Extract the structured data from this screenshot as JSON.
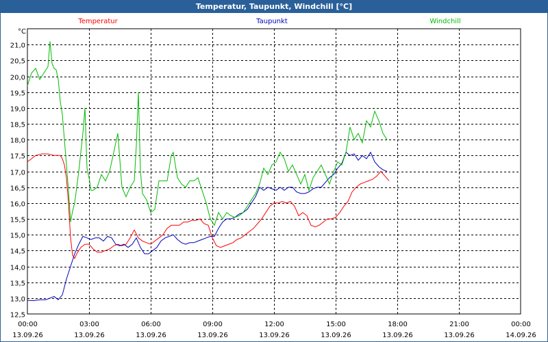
{
  "window": {
    "title": "Temperatur, Taupunkt, Windchill [°C]"
  },
  "chart_data": {
    "type": "line",
    "title": "Temperatur, Taupunkt, Windchill [°C]",
    "ylabel": "°C",
    "xlabel": "",
    "ylim": [
      12.5,
      21.5
    ],
    "y_ticks": [
      "12,5",
      "13,0",
      "13,5",
      "14,0",
      "14,5",
      "15,0",
      "15,5",
      "16,0",
      "16,5",
      "17,0",
      "17,5",
      "18,0",
      "18,5",
      "19,0",
      "19,5",
      "20,0",
      "20,5",
      "21,0"
    ],
    "xlim_hours": [
      0,
      24
    ],
    "x_ticks": [
      {
        "time": "00:00",
        "date": "13.09.26"
      },
      {
        "time": "03:00",
        "date": "13.09.26"
      },
      {
        "time": "06:00",
        "date": "13.09.26"
      },
      {
        "time": "09:00",
        "date": "13.09.26"
      },
      {
        "time": "12:00",
        "date": "13.09.26"
      },
      {
        "time": "15:00",
        "date": "13.09.26"
      },
      {
        "time": "18:00",
        "date": "13.09.26"
      },
      {
        "time": "21:00",
        "date": "13.09.26"
      },
      {
        "time": "00:00",
        "date": "14.09.26"
      }
    ],
    "grid": true,
    "legend_placement": "top",
    "series": [
      {
        "name": "Temperatur",
        "color": "#ff0000",
        "x": [
          0.0,
          0.2,
          0.4,
          0.7,
          1.0,
          1.3,
          1.6,
          1.7,
          1.8,
          1.9,
          2.0,
          2.1,
          2.2,
          2.3,
          2.4,
          2.6,
          2.8,
          3.0,
          3.2,
          3.4,
          3.6,
          3.8,
          4.0,
          4.2,
          4.4,
          4.6,
          4.8,
          5.0,
          5.2,
          5.4,
          5.6,
          5.8,
          6.0,
          6.2,
          6.4,
          6.6,
          6.8,
          7.0,
          7.2,
          7.4,
          7.6,
          7.8,
          8.0,
          8.2,
          8.4,
          8.6,
          8.8,
          9.0,
          9.2,
          9.4,
          9.6,
          9.8,
          10.0,
          10.2,
          10.4,
          10.6,
          10.8,
          11.0,
          11.2,
          11.4,
          11.6,
          11.8,
          12.0,
          12.2,
          12.4,
          12.6,
          12.8,
          13.0,
          13.2,
          13.4,
          13.6,
          13.8,
          14.0,
          14.2,
          14.4,
          14.6,
          14.8,
          15.0,
          15.2,
          15.4,
          15.6,
          15.8,
          16.0,
          16.2,
          16.4,
          16.6,
          16.8,
          17.0,
          17.2,
          17.4,
          17.6
        ],
        "values": [
          17.3,
          17.4,
          17.5,
          17.55,
          17.55,
          17.5,
          17.5,
          17.4,
          17.2,
          16.8,
          16.0,
          14.9,
          14.35,
          14.25,
          14.4,
          14.6,
          14.7,
          14.7,
          14.55,
          14.45,
          14.45,
          14.5,
          14.55,
          14.65,
          14.7,
          14.65,
          14.7,
          14.9,
          15.15,
          14.9,
          14.8,
          14.75,
          14.7,
          14.8,
          14.9,
          15.0,
          15.2,
          15.3,
          15.3,
          15.3,
          15.4,
          15.4,
          15.45,
          15.45,
          15.5,
          15.35,
          15.3,
          14.9,
          14.65,
          14.6,
          14.65,
          14.7,
          14.75,
          14.85,
          14.9,
          15.0,
          15.1,
          15.2,
          15.35,
          15.5,
          15.7,
          15.9,
          16.0,
          16.0,
          16.05,
          16.0,
          16.05,
          15.9,
          15.6,
          15.7,
          15.6,
          15.3,
          15.25,
          15.3,
          15.4,
          15.5,
          15.5,
          15.55,
          15.7,
          15.9,
          16.05,
          16.35,
          16.5,
          16.6,
          16.65,
          16.7,
          16.75,
          16.85,
          17.0,
          16.85,
          16.7
        ]
      },
      {
        "name": "Taupunkt",
        "color": "#0000c0",
        "x": [
          0.0,
          0.3,
          0.6,
          0.9,
          1.1,
          1.3,
          1.5,
          1.7,
          1.9,
          2.1,
          2.3,
          2.5,
          2.7,
          2.9,
          3.1,
          3.3,
          3.5,
          3.7,
          3.9,
          4.1,
          4.3,
          4.5,
          4.7,
          4.9,
          5.1,
          5.3,
          5.5,
          5.7,
          5.9,
          6.1,
          6.3,
          6.5,
          6.7,
          6.9,
          7.1,
          7.3,
          7.5,
          7.7,
          7.9,
          8.1,
          8.3,
          8.5,
          8.7,
          8.9,
          9.1,
          9.3,
          9.5,
          9.7,
          9.9,
          10.1,
          10.3,
          10.5,
          10.7,
          10.9,
          11.1,
          11.3,
          11.5,
          11.7,
          11.9,
          12.1,
          12.3,
          12.5,
          12.7,
          12.9,
          13.1,
          13.3,
          13.5,
          13.7,
          13.9,
          14.1,
          14.3,
          14.5,
          14.7,
          14.9,
          15.1,
          15.3,
          15.5,
          15.7,
          15.9,
          16.1,
          16.3,
          16.5,
          16.7,
          16.9,
          17.1,
          17.3,
          17.5
        ],
        "values": [
          12.93,
          12.92,
          12.95,
          12.95,
          13.0,
          13.05,
          12.95,
          13.1,
          13.6,
          14.0,
          14.4,
          14.7,
          14.95,
          14.9,
          14.85,
          14.9,
          14.9,
          14.8,
          14.95,
          14.9,
          14.7,
          14.65,
          14.7,
          14.6,
          14.7,
          14.9,
          14.6,
          14.4,
          14.4,
          14.5,
          14.6,
          14.8,
          14.9,
          14.95,
          15.0,
          14.85,
          14.75,
          14.7,
          14.75,
          14.75,
          14.8,
          14.85,
          14.9,
          14.95,
          14.95,
          15.2,
          15.4,
          15.5,
          15.5,
          15.55,
          15.65,
          15.7,
          15.8,
          16.0,
          16.2,
          16.5,
          16.4,
          16.5,
          16.45,
          16.4,
          16.5,
          16.4,
          16.5,
          16.5,
          16.35,
          16.3,
          16.3,
          16.35,
          16.45,
          16.5,
          16.5,
          16.65,
          16.8,
          16.9,
          17.1,
          17.25,
          17.6,
          17.5,
          17.55,
          17.35,
          17.5,
          17.4,
          17.6,
          17.3,
          17.15,
          17.05,
          17.0
        ]
      },
      {
        "name": "Windchill",
        "color": "#00bb00",
        "x": [
          0.0,
          0.2,
          0.4,
          0.6,
          0.8,
          1.0,
          1.1,
          1.2,
          1.3,
          1.4,
          1.5,
          1.6,
          1.7,
          1.8,
          1.9,
          2.0,
          2.1,
          2.2,
          2.3,
          2.4,
          2.5,
          2.6,
          2.7,
          2.8,
          2.9,
          3.0,
          3.1,
          3.2,
          3.4,
          3.6,
          3.8,
          4.0,
          4.2,
          4.4,
          4.6,
          4.8,
          5.0,
          5.2,
          5.3,
          5.4,
          5.5,
          5.6,
          5.8,
          6.0,
          6.2,
          6.4,
          6.6,
          6.8,
          7.0,
          7.1,
          7.3,
          7.5,
          7.7,
          7.9,
          8.1,
          8.3,
          8.5,
          8.7,
          8.9,
          9.1,
          9.3,
          9.5,
          9.7,
          9.9,
          10.1,
          10.3,
          10.5,
          10.7,
          10.9,
          11.1,
          11.3,
          11.5,
          11.7,
          11.9,
          12.1,
          12.3,
          12.5,
          12.7,
          12.9,
          13.1,
          13.3,
          13.5,
          13.7,
          13.9,
          14.1,
          14.3,
          14.5,
          14.7,
          14.9,
          15.1,
          15.3,
          15.5,
          15.7,
          15.9,
          16.1,
          16.3,
          16.5,
          16.7,
          16.9,
          17.1,
          17.3,
          17.5
        ],
        "values": [
          19.7,
          20.1,
          20.25,
          19.9,
          20.1,
          20.3,
          21.1,
          20.4,
          20.25,
          20.2,
          19.9,
          19.2,
          18.8,
          18.0,
          17.2,
          16.4,
          15.4,
          15.75,
          16.0,
          16.5,
          17.0,
          17.6,
          18.2,
          19.0,
          17.1,
          16.8,
          16.4,
          16.4,
          16.5,
          16.9,
          16.7,
          17.0,
          17.6,
          18.2,
          16.5,
          16.2,
          16.5,
          16.7,
          17.8,
          19.5,
          17.0,
          16.3,
          16.1,
          15.7,
          15.8,
          16.7,
          16.7,
          16.7,
          17.5,
          17.6,
          16.8,
          16.6,
          16.5,
          16.7,
          16.7,
          16.8,
          16.4,
          16.0,
          15.5,
          15.3,
          15.7,
          15.5,
          15.7,
          15.6,
          15.55,
          15.6,
          15.7,
          15.9,
          16.1,
          16.3,
          16.6,
          17.1,
          16.9,
          17.2,
          17.3,
          17.6,
          17.4,
          17.0,
          17.2,
          16.9,
          16.6,
          16.9,
          16.4,
          16.8,
          17.0,
          17.2,
          16.9,
          16.6,
          17.0,
          17.3,
          17.2,
          17.6,
          18.4,
          18.0,
          18.2,
          17.9,
          18.6,
          18.4,
          18.9,
          18.6,
          18.2,
          18.0
        ]
      }
    ]
  }
}
